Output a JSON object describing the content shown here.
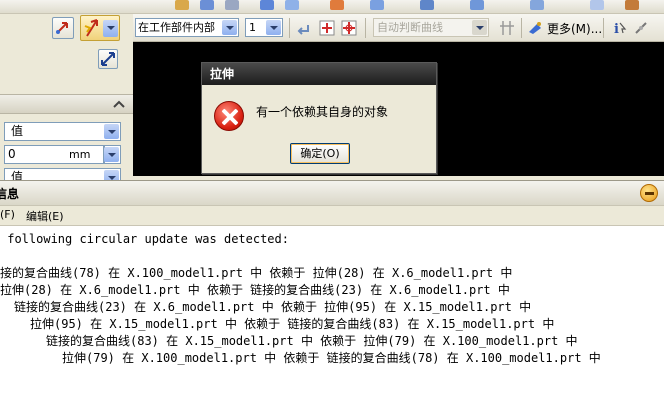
{
  "dialog": {
    "title": "拉伸",
    "message": "有一个依赖其自身的对象",
    "ok_label": "确定(O)"
  },
  "toolbar": {
    "selection_scope": "在工作部件内部",
    "count_value": "1",
    "auto_label": "自动判断曲线",
    "more_label": "更多(M)..."
  },
  "left_panel": {
    "field1_value": "值",
    "distance_value": "0",
    "distance_unit": "mm",
    "field3_value": "值"
  },
  "info_window": {
    "title": "信息",
    "menu": [
      "(F)",
      "编辑(E)"
    ],
    "lines": [
      " following circular update was detected:",
      "接的复合曲线(78) 在 X.100_model1.prt 中 依赖于 拉伸(28) 在 X.6_model1.prt 中",
      "拉伸(28) 在 X.6_model1.prt 中 依赖于 链接的复合曲线(23) 在 X.6_model1.prt 中",
      "链接的复合曲线(23) 在 X.6_model1.prt 中 依赖于 拉伸(95) 在 X.15_model1.prt 中",
      "拉伸(95) 在 X.15_model1.prt 中 依赖于 链接的复合曲线(83) 在 X.15_model1.prt 中",
      "链接的复合曲线(83) 在 X.15_model1.prt 中 依赖于 拉伸(79) 在 X.100_model1.prt 中",
      "拉伸(79) 在 X.100_model1.prt 中 依赖于 链接的复合曲线(78) 在 X.100_model1.prt 中"
    ]
  },
  "colors": {
    "graphics_bg": "#000000",
    "dialog_title_bg": "#1d1d1d",
    "error_red": "#d81f10"
  }
}
